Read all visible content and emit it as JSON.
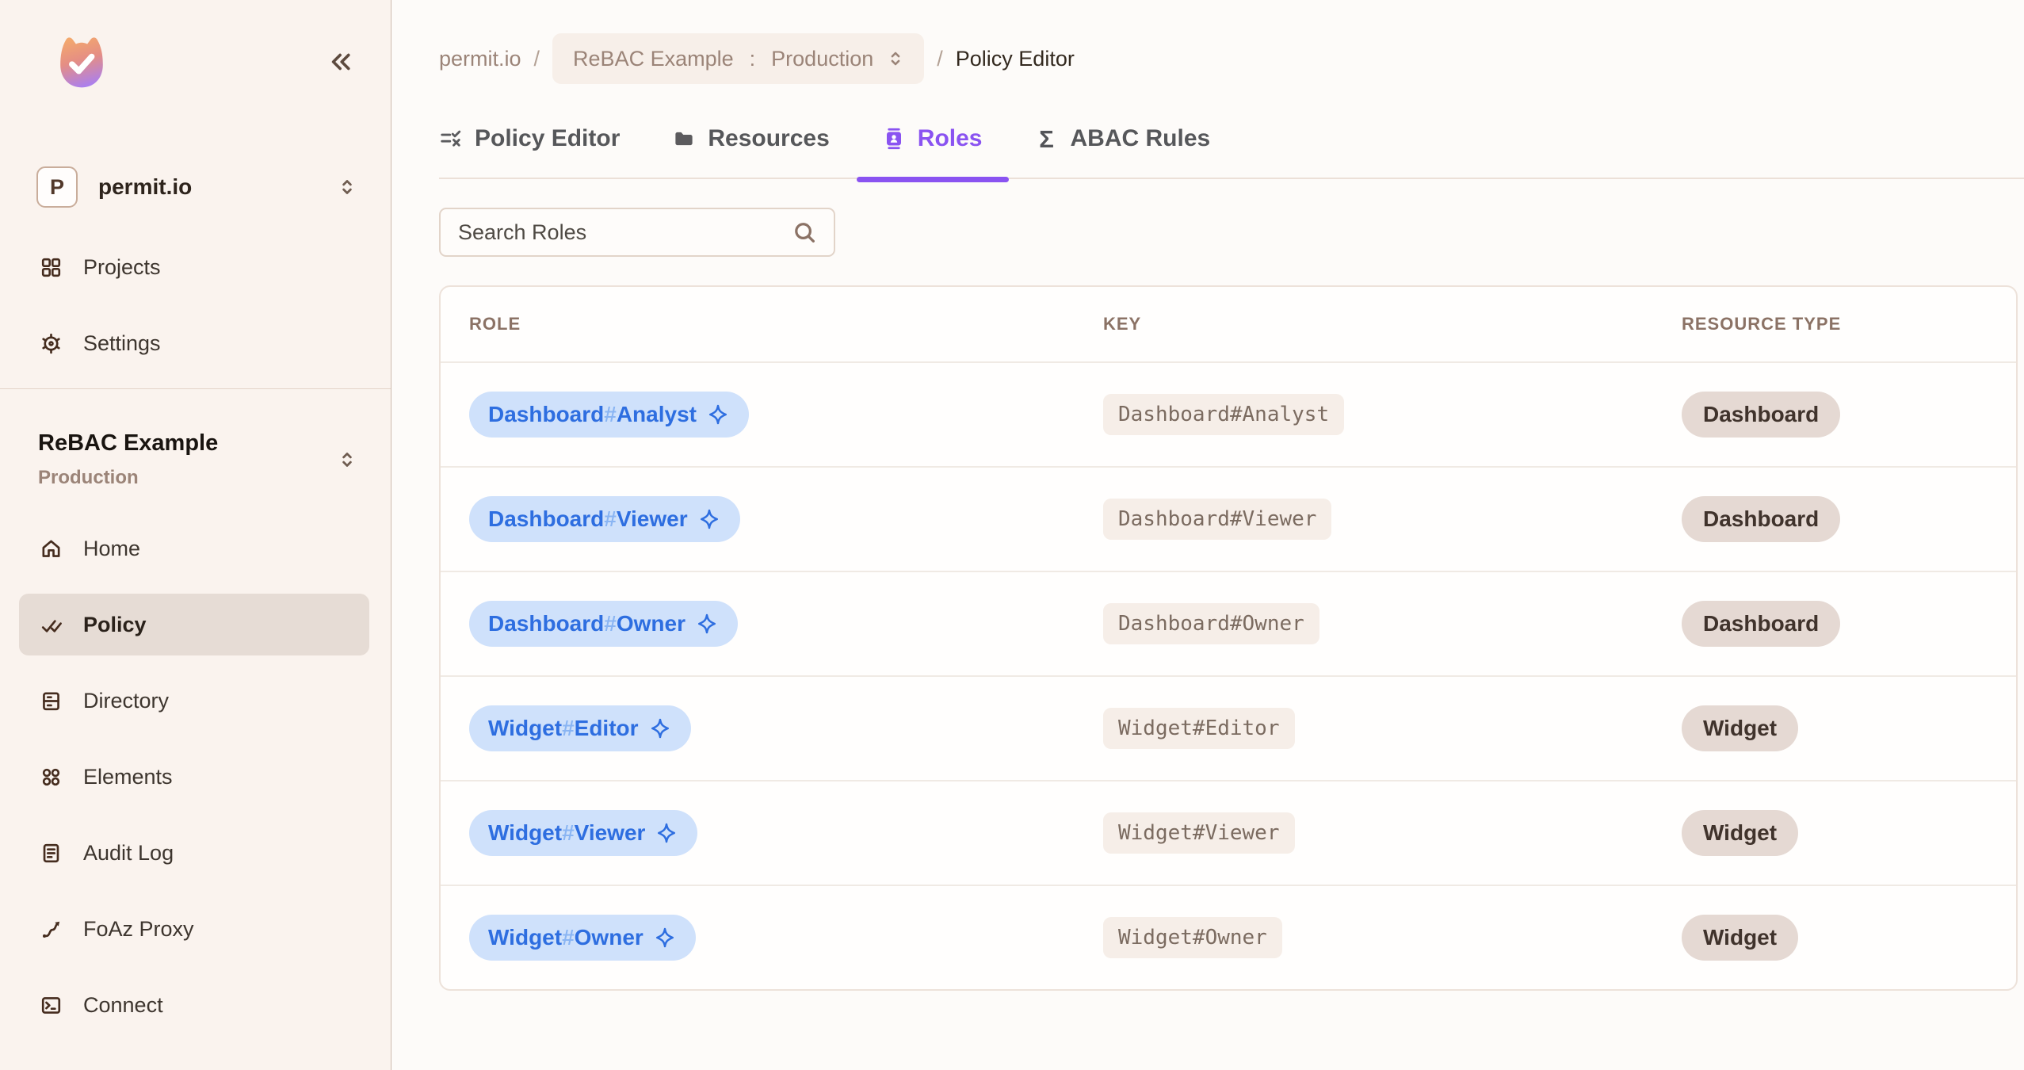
{
  "sidebar": {
    "org": {
      "initial": "P",
      "name": "permit.io"
    },
    "items_top": [
      {
        "label": "Projects"
      },
      {
        "label": "Settings"
      }
    ],
    "project": {
      "name": "ReBAC Example",
      "environment": "Production"
    },
    "items_project": [
      {
        "label": "Home"
      },
      {
        "label": "Policy",
        "active": true
      },
      {
        "label": "Directory"
      },
      {
        "label": "Elements"
      },
      {
        "label": "Audit Log"
      },
      {
        "label": "FoAz Proxy"
      },
      {
        "label": "Connect"
      }
    ]
  },
  "breadcrumb": {
    "org": "permit.io",
    "sep": "/",
    "project": "ReBAC Example",
    "colon": ":",
    "environment": "Production",
    "page": "Policy Editor"
  },
  "tabs": [
    {
      "label": "Policy Editor",
      "active": false
    },
    {
      "label": "Resources",
      "active": false
    },
    {
      "label": "Roles",
      "active": true
    },
    {
      "label": "ABAC Rules",
      "active": false
    }
  ],
  "search": {
    "placeholder": "Search Roles"
  },
  "table": {
    "columns": [
      "ROLE",
      "KEY",
      "RESOURCE TYPE"
    ],
    "rows": [
      {
        "role_resource": "Dashboard",
        "role_hash": "#",
        "role_name": "Analyst",
        "key": "Dashboard#Analyst",
        "resource_type": "Dashboard"
      },
      {
        "role_resource": "Dashboard",
        "role_hash": "#",
        "role_name": "Viewer",
        "key": "Dashboard#Viewer",
        "resource_type": "Dashboard"
      },
      {
        "role_resource": "Dashboard",
        "role_hash": "#",
        "role_name": "Owner",
        "key": "Dashboard#Owner",
        "resource_type": "Dashboard"
      },
      {
        "role_resource": "Widget",
        "role_hash": "#",
        "role_name": "Editor",
        "key": "Widget#Editor",
        "resource_type": "Widget"
      },
      {
        "role_resource": "Widget",
        "role_hash": "#",
        "role_name": "Viewer",
        "key": "Widget#Viewer",
        "resource_type": "Widget"
      },
      {
        "role_resource": "Widget",
        "role_hash": "#",
        "role_name": "Owner",
        "key": "Widget#Owner",
        "resource_type": "Widget"
      }
    ]
  },
  "colors": {
    "accent_purple": "#8a53f1",
    "role_blue": "#2e6ee0",
    "role_blue_bg": "#cfe1fb",
    "sidebar_bg": "#faf3ee",
    "active_item_bg": "#e6dcd5",
    "resource_tag_bg": "#e5d9d3",
    "key_tag_bg": "#f6eee8",
    "logo_gradient_top": "#f3a86d",
    "logo_gradient_bottom": "#a97ff2"
  }
}
